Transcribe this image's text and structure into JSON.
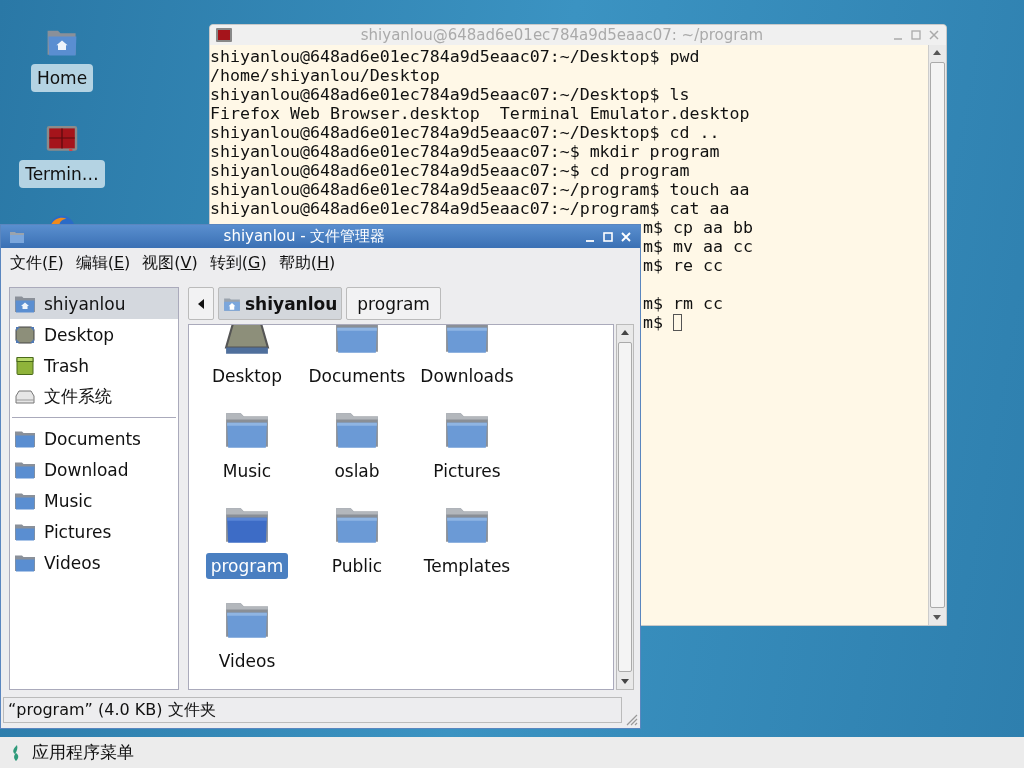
{
  "desktop_icons": [
    {
      "kind": "home",
      "label": "Home"
    },
    {
      "kind": "terminal",
      "label": "Termin…"
    },
    {
      "kind": "browser"
    }
  ],
  "terminal": {
    "title": "shiyanlou@648ad6e01ec784a9d5eaac07: ~/program",
    "lines": [
      {
        "kind": "full",
        "text": "shiyanlou@648ad6e01ec784a9d5eaac07:~/Desktop$ pwd"
      },
      {
        "kind": "full",
        "text": "/home/shiyanlou/Desktop"
      },
      {
        "kind": "full",
        "text": "shiyanlou@648ad6e01ec784a9d5eaac07:~/Desktop$ ls"
      },
      {
        "kind": "full",
        "text": "Firefox Web Browser.desktop  Terminal Emulator.desktop"
      },
      {
        "kind": "full",
        "text": "shiyanlou@648ad6e01ec784a9d5eaac07:~/Desktop$ cd .."
      },
      {
        "kind": "full",
        "text": "shiyanlou@648ad6e01ec784a9d5eaac07:~$ mkdir program"
      },
      {
        "kind": "full",
        "text": "shiyanlou@648ad6e01ec784a9d5eaac07:~$ cd program"
      },
      {
        "kind": "full",
        "text": "shiyanlou@648ad6e01ec784a9d5eaac07:~/program$ touch aa"
      },
      {
        "kind": "full",
        "text": "shiyanlou@648ad6e01ec784a9d5eaac07:~/program$ cat aa"
      },
      {
        "kind": "clipped",
        "text": "m$ cp aa bb"
      },
      {
        "kind": "clipped",
        "text": "m$ mv aa cc"
      },
      {
        "kind": "clipped",
        "text": "m$ re cc"
      },
      {
        "kind": "blank"
      },
      {
        "kind": "clipped",
        "text": "m$ rm cc"
      },
      {
        "kind": "clipped",
        "text": "m$",
        "cursor": true
      }
    ]
  },
  "file_manager": {
    "title": "shiyanlou - 文件管理器",
    "menu": [
      {
        "text": "文件(",
        "mnemonic": "F",
        "after": ")"
      },
      {
        "text": "编辑(",
        "mnemonic": "E",
        "after": ")"
      },
      {
        "text": "视图(",
        "mnemonic": "V",
        "after": ")"
      },
      {
        "text": "转到(",
        "mnemonic": "G",
        "after": ")"
      },
      {
        "text": "帮助(",
        "mnemonic": "H",
        "after": ")"
      }
    ],
    "sidebar": {
      "places": [
        {
          "kind": "home",
          "label": "shiyanlou",
          "selected": true
        },
        {
          "kind": "desktop",
          "label": "Desktop",
          "selected": false
        },
        {
          "kind": "trash",
          "label": "Trash",
          "selected": false
        },
        {
          "kind": "disk",
          "label": "文件系统",
          "selected": false
        }
      ],
      "bookmarks": [
        {
          "kind": "folder",
          "label": "Documents",
          "selected": false
        },
        {
          "kind": "folder",
          "label": "Download",
          "selected": false
        },
        {
          "kind": "folder",
          "label": "Music",
          "selected": false
        },
        {
          "kind": "folder",
          "label": "Pictures",
          "selected": false
        },
        {
          "kind": "folder",
          "label": "Videos",
          "selected": false
        }
      ]
    },
    "path": [
      {
        "label": "shiyanlou",
        "kind": "home",
        "selected": true
      },
      {
        "label": "program",
        "kind": "folder",
        "selected": false
      }
    ],
    "items": [
      {
        "kind": "desktop",
        "label": "Desktop",
        "selected": false
      },
      {
        "kind": "folder",
        "label": "Documents",
        "selected": false
      },
      {
        "kind": "folder",
        "label": "Downloads",
        "selected": false
      },
      {
        "kind": "folder",
        "label": "Music",
        "selected": false
      },
      {
        "kind": "folder",
        "label": "oslab",
        "selected": false
      },
      {
        "kind": "folder",
        "label": "Pictures",
        "selected": false
      },
      {
        "kind": "folder",
        "label": "program",
        "selected": true
      },
      {
        "kind": "folder",
        "label": "Public",
        "selected": false
      },
      {
        "kind": "folder",
        "label": "Templates",
        "selected": false
      },
      {
        "kind": "folder",
        "label": "Videos",
        "selected": false
      }
    ],
    "status": "“program” (4.0 KB) 文件夹"
  },
  "taskbar": {
    "menu_label": "应用程序菜单"
  }
}
